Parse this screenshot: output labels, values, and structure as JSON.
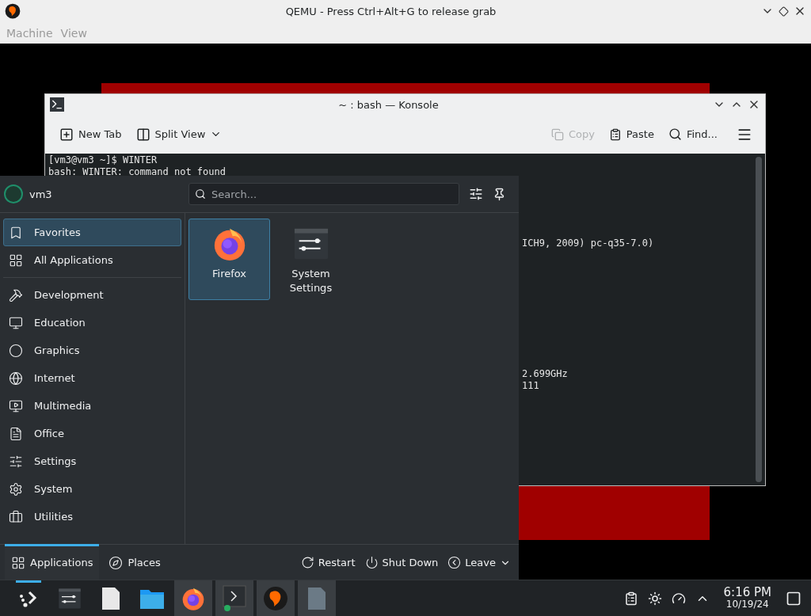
{
  "qemu_window": {
    "title": "QEMU - Press Ctrl+Alt+G to release grab",
    "menu": [
      {
        "label": "Machine",
        "disabled": true
      },
      {
        "label": "View",
        "disabled": true
      }
    ]
  },
  "konsole": {
    "title": "~ : bash — Konsole",
    "toolbar": [
      {
        "label": "New Tab",
        "kind": "new-tab",
        "disabled": false
      },
      {
        "label": "Split View",
        "kind": "split",
        "disabled": false
      },
      {
        "label": "Copy",
        "kind": "copy",
        "disabled": true
      },
      {
        "label": "Paste",
        "kind": "paste",
        "disabled": false
      },
      {
        "label": "Find...",
        "kind": "find",
        "disabled": false
      }
    ],
    "lines": [
      {
        "text": "[vm3@vm3 ~]$ WINTER",
        "kind": "full"
      },
      {
        "text": "bash: WINTER: command not found",
        "kind": "full"
      },
      {
        "text": "ICH9, 2009) pc-q35-7.0)",
        "kind": "partial"
      },
      {
        "text": "2.699GHz",
        "kind": "partial"
      },
      {
        "text": "111",
        "kind": "partial"
      }
    ]
  },
  "launcher": {
    "user": "vm3",
    "search": {
      "placeholder": "Search..."
    },
    "categories": [
      {
        "label": "Favorites",
        "kind": "favorites",
        "selected": true
      },
      {
        "label": "All Applications",
        "kind": "all",
        "selected": false
      },
      {
        "label": "Development",
        "kind": "development",
        "selected": false
      },
      {
        "label": "Education",
        "kind": "education",
        "selected": false
      },
      {
        "label": "Graphics",
        "kind": "graphics",
        "selected": false
      },
      {
        "label": "Internet",
        "kind": "internet",
        "selected": false
      },
      {
        "label": "Multimedia",
        "kind": "multimedia",
        "selected": false
      },
      {
        "label": "Office",
        "kind": "office",
        "selected": false
      },
      {
        "label": "Settings",
        "kind": "settings",
        "selected": false
      },
      {
        "label": "System",
        "kind": "system",
        "selected": false
      },
      {
        "label": "Utilities",
        "kind": "utilities",
        "selected": false
      }
    ],
    "apps": [
      {
        "label": "Firefox",
        "kind": "firefox",
        "selected": true
      },
      {
        "label": "System Settings",
        "kind": "settings",
        "selected": false
      }
    ],
    "tabs": [
      {
        "label": "Applications",
        "kind": "apps",
        "selected": true
      },
      {
        "label": "Places",
        "kind": "places",
        "selected": false
      }
    ],
    "actions": [
      {
        "label": "Restart",
        "kind": "restart"
      },
      {
        "label": "Shut Down",
        "kind": "shutdown"
      },
      {
        "label": "Leave",
        "kind": "leave"
      }
    ]
  },
  "taskbar": {
    "tasks": [
      {
        "kind": "launcher",
        "running": true
      },
      {
        "kind": "settings",
        "running": false
      },
      {
        "kind": "text",
        "running": false
      },
      {
        "kind": "folder",
        "running": false
      },
      {
        "kind": "firefox",
        "running": true
      },
      {
        "kind": "konsole",
        "running": true
      },
      {
        "kind": "qemu",
        "running": true
      },
      {
        "kind": "document",
        "running": true
      }
    ],
    "clock": {
      "time": "6:16 PM",
      "date": "10/19/24"
    }
  }
}
